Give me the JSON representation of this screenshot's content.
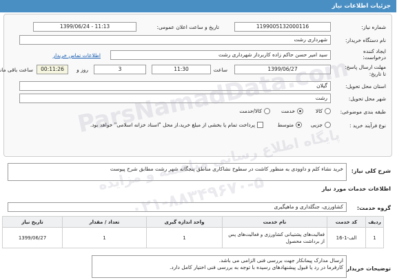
{
  "header": {
    "title": "جزئیات اطلاعات نیاز"
  },
  "form": {
    "need_number_label": "شماره نیاز:",
    "need_number": "1199005132000116",
    "announce_label": "تاریخ و ساعت اعلان عمومی:",
    "announce_value": "1399/06/24 - 11:13",
    "buyer_org_label": "نام دستگاه خریدار:",
    "buyer_org": "شهرداری رشت",
    "creator_label": "ایجاد کننده درخواست:",
    "creator": "سید امیر حسن حاکم زاده کاربرداز  شهرداری رشت",
    "contact_link": "اطلاعات تماس خریدار",
    "deadline_label": "مهلت ارسال پاسخ:",
    "deadline_label2": "تا تاریخ:",
    "deadline_date": "1399/06/27",
    "time_label": "ساعت",
    "deadline_time": "11:30",
    "days_value": "3",
    "days_label": "روز و",
    "countdown": "00:11:26",
    "remaining_label": "ساعت باقی مانده",
    "province_label": "استان محل تحویل:",
    "province": "گیلان",
    "city_label": "شهر محل تحویل:",
    "city": "رشت",
    "category_label": "طبقه بندی موضوعی:",
    "category_options": [
      "کالا",
      "خدمت",
      "کالا/خدمت"
    ],
    "purchase_type_label": "نوع فرآیند خرید :",
    "purchase_options": [
      "جزیی",
      "متوسط"
    ],
    "payment_note": "پرداخت تمام یا بخشی از مبلغ خرید،از محل \"اسناد خزانه اسلامی\" خواهد بود."
  },
  "summary": {
    "label": "شرح کلی نیاز:",
    "text": "خرید نشاء کلم و داوودی به منظور کاشت در سطوح نشاکاری مناطق پنجگانه شهر رشت مطابق شرح پیوست"
  },
  "services": {
    "section_title": "اطلاعات خدمات مورد نیاز",
    "group_label": "گروه خدمت:",
    "group_value": "کشاورزی، جنگلداری و ماهیگیری",
    "columns": [
      "ردیف",
      "کد خدمت",
      "نام خدمت",
      "واحد اندازه گیری",
      "تعداد / مقدار",
      "تاریخ نیاز"
    ],
    "rows": [
      [
        "1",
        "الف-1-16",
        "فعالیت‌های پشتیبانی کشاورزی و فعالیت‌های پس از برداشت محصول",
        "1",
        "1",
        "1399/06/27"
      ]
    ]
  },
  "notes": {
    "label": "توضیحات خریدار:",
    "lines": [
      "ارسال مدارک  پیمانکار جهت بررسی فنی الزامی می باشد.",
      "کارفرما در رد یا قبول پیشنهادهای رسیده با توجه به بررسی فنی اختیار کامل دارد."
    ]
  },
  "watermark": {
    "brand": "ParsNamadData.com",
    "line1": "پایگاه اطلاع رسانی مناقصه و مزایده",
    "phone": "۰۲۱-۸۸۳۴۹۶۷۰-۵"
  }
}
